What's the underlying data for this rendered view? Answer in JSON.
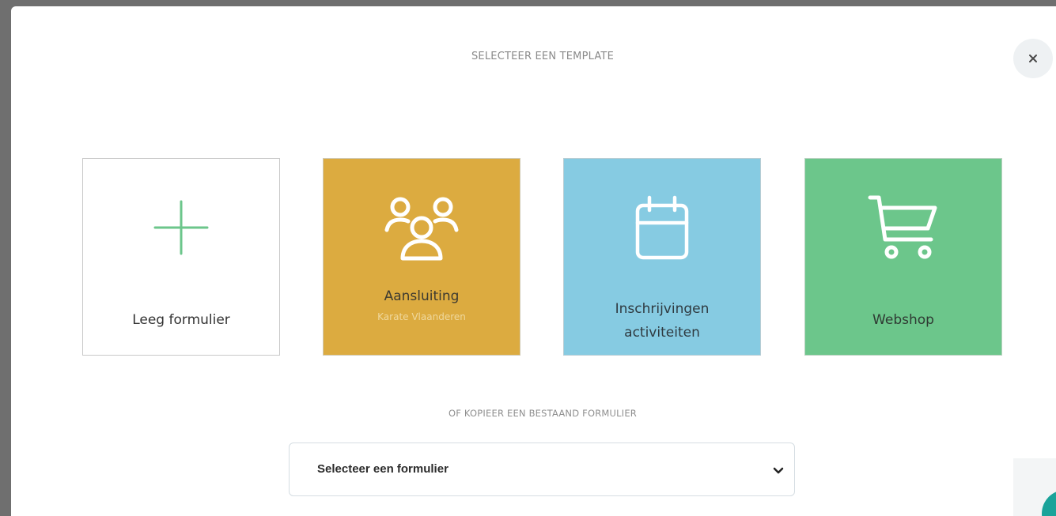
{
  "modal": {
    "title": "SELECTEER EEN TEMPLATE",
    "close_icon": "close-icon"
  },
  "templates": [
    {
      "label": "Leeg formulier",
      "icon": "plus-icon",
      "color": "#ffffff",
      "icon_color": "#6cc68b"
    },
    {
      "label": "Aansluiting",
      "subtitle": "Karate Vlaanderen",
      "icon": "users-icon",
      "color": "#dcab40",
      "icon_color": "#ffffff"
    },
    {
      "label": "Inschrijvingen activiteiten",
      "icon": "calendar-icon",
      "color": "#86cbe2",
      "icon_color": "#ffffff"
    },
    {
      "label": "Webshop",
      "icon": "shopping-cart-icon",
      "color": "#6cc68b",
      "icon_color": "#ffffff"
    }
  ],
  "copy": {
    "title": "OF KOPIEER EEN BESTAAND FORMULIER",
    "select_value": "Selecteer een formulier",
    "select_icon": "chevron-down-icon"
  }
}
